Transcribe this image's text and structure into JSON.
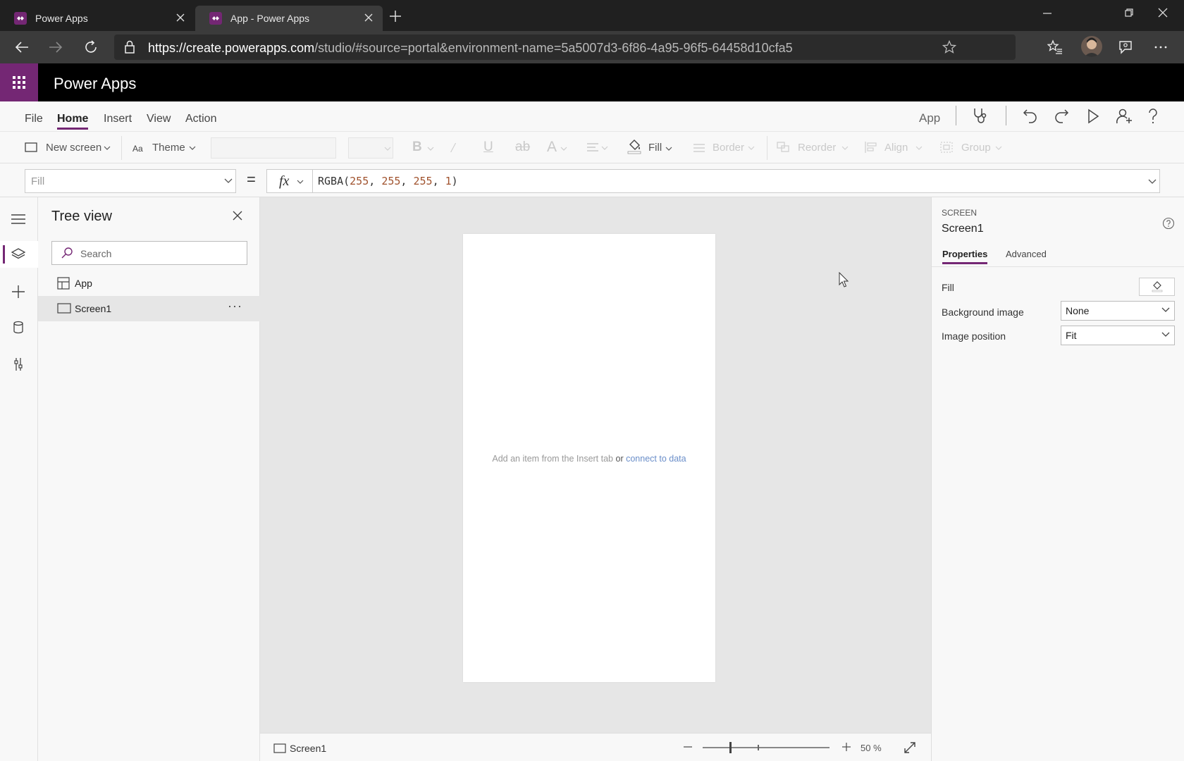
{
  "browser": {
    "tabs": [
      {
        "title": "Power Apps"
      },
      {
        "title": "App - Power Apps"
      }
    ],
    "url_host": "https://create.powerapps.com",
    "url_rest": "/studio/#source=portal&environment-name=5a5007d3-6f86-4a95-96f5-64458d10cfa5"
  },
  "app": {
    "title": "Power Apps"
  },
  "menu": {
    "tabs": [
      "File",
      "Home",
      "Insert",
      "View",
      "Action"
    ],
    "active_tab": "Home",
    "app_button": "App"
  },
  "ribbon": {
    "new_screen": "New screen",
    "theme": "Theme",
    "fill": "Fill",
    "border": "Border",
    "reorder": "Reorder",
    "align": "Align",
    "group": "Group"
  },
  "formula_bar": {
    "property": "Fill",
    "equals": "=",
    "fx": "fx",
    "formula_fn": "RGBA(",
    "formula_args": [
      "255",
      "255",
      "255",
      "1"
    ],
    "formula_close": ")"
  },
  "tree_view": {
    "title": "Tree view",
    "search_placeholder": "Search",
    "items": [
      {
        "label": "App",
        "selected": false
      },
      {
        "label": "Screen1",
        "selected": true
      }
    ],
    "more": "···"
  },
  "canvas": {
    "hint_prefix": "Add an item from the Insert tab",
    "hint_or": "or",
    "hint_link": "connect to data"
  },
  "status_bar": {
    "screen_label": "Screen1",
    "zoom_percent": 50,
    "zoom_label": "50  %"
  },
  "properties": {
    "type_label": "SCREEN",
    "name": "Screen1",
    "tabs": [
      "Properties",
      "Advanced"
    ],
    "active_tab": "Properties",
    "fill_label": "Fill",
    "background_image_label": "Background image",
    "background_image_value": "None",
    "image_position_label": "Image position",
    "image_position_value": "Fit"
  },
  "colors": {
    "brand": "#742774",
    "header_bg": "#000000",
    "chrome_dark": "#202020",
    "canvas_bg": "#e6e6e6"
  }
}
